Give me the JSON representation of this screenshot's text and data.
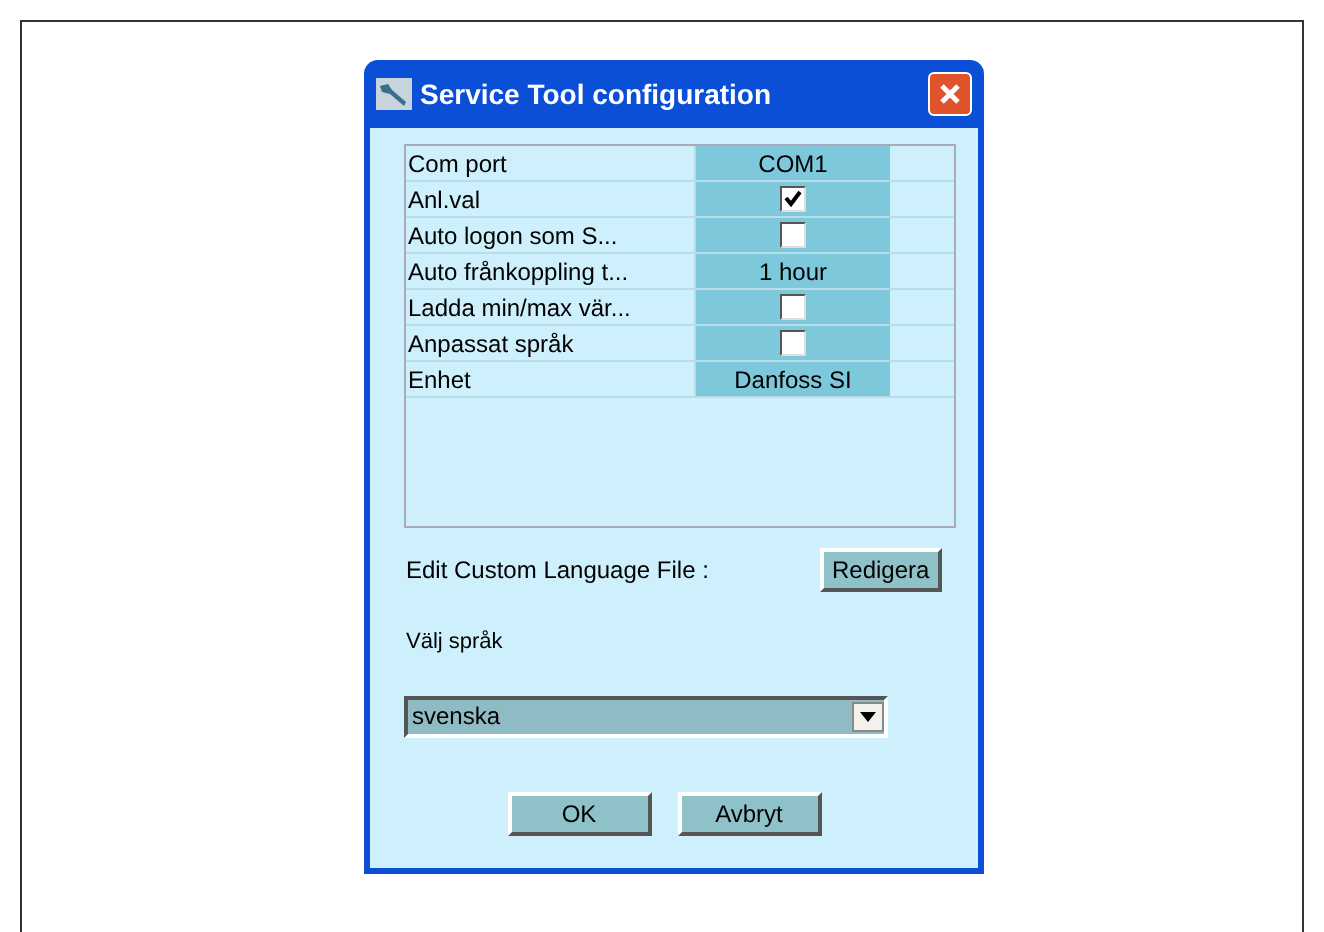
{
  "dialog": {
    "title": "Service Tool configuration",
    "settings": [
      {
        "label": "Com port",
        "kind": "text",
        "value": "COM1"
      },
      {
        "label": "Anl.val",
        "kind": "checkbox",
        "checked": true
      },
      {
        "label": "Auto logon som S...",
        "kind": "checkbox",
        "checked": false
      },
      {
        "label": "Auto frånkoppling t...",
        "kind": "text",
        "value": "1 hour"
      },
      {
        "label": "Ladda min/max vär...",
        "kind": "checkbox",
        "checked": false
      },
      {
        "label": "Anpassat språk",
        "kind": "checkbox",
        "checked": false
      },
      {
        "label": "Enhet",
        "kind": "text",
        "value": "Danfoss SI"
      }
    ],
    "custom_language": {
      "label": "Edit Custom Language File :",
      "button": "Redigera"
    },
    "language": {
      "label": "Välj språk",
      "value": "svenska"
    },
    "buttons": [
      "OK",
      "Avbryt"
    ]
  }
}
